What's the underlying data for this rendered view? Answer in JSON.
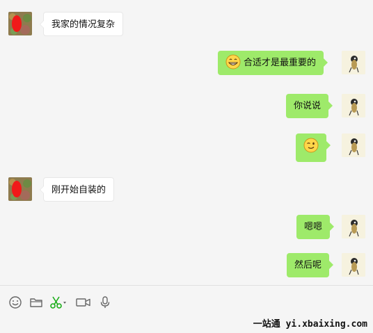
{
  "messages": [
    {
      "side": "in",
      "text": "我家的情况复杂",
      "emoji": ""
    },
    {
      "side": "out",
      "text": "合适才是最重要的",
      "emoji": "grinning-face"
    },
    {
      "side": "out",
      "text": "你说说",
      "emoji": ""
    },
    {
      "side": "out",
      "text": "",
      "emoji": "winking-face"
    },
    {
      "side": "in",
      "text": "刚开始自装的",
      "emoji": ""
    },
    {
      "side": "out",
      "text": "嗯嗯",
      "emoji": ""
    },
    {
      "side": "out",
      "text": "然后呢",
      "emoji": ""
    }
  ],
  "toolbar": {
    "icons": [
      "emoji-icon",
      "folder-icon",
      "scissors-icon",
      "video-icon",
      "microphone-icon"
    ]
  },
  "watermark": "一站通 yi.xbaixing.com",
  "colors": {
    "background": "#f5f5f5",
    "outgoing_bubble": "#9eea6a",
    "incoming_bubble": "#ffffff",
    "scissors_green": "#1aad19"
  }
}
